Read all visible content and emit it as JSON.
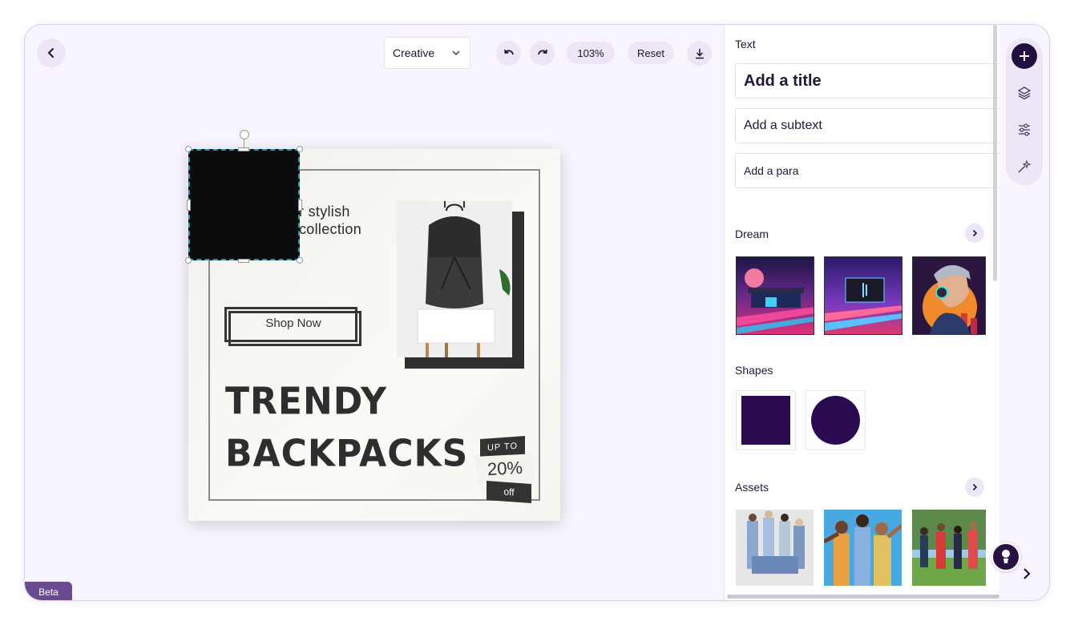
{
  "toolbar": {
    "mode_select": "Creative",
    "zoom": "103%",
    "reset_label": "Reset"
  },
  "design": {
    "tagline_line1": "r stylish",
    "tagline_line2": "collection",
    "shop_button": "Shop Now",
    "headline_line1": "TRENDY",
    "headline_line2": "BACKPACKS",
    "badge_top": "UP TO",
    "badge_value": "20%",
    "badge_bottom": "off"
  },
  "panel": {
    "text_section": "Text",
    "add_title": "Add a title",
    "add_subtext": "Add a subtext",
    "add_para": "Add a para",
    "dream_section": "Dream",
    "shapes_section": "Shapes",
    "assets_section": "Assets"
  },
  "colors": {
    "brand": "#24103f",
    "shape_fill": "#2b0a52",
    "selection": "#1d9bb2"
  },
  "footer": {
    "beta": "Beta"
  }
}
